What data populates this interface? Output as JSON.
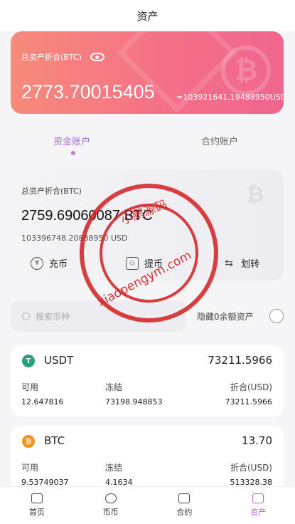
{
  "header": {
    "title": "资产"
  },
  "hero": {
    "label": "总资产折合(BTC)",
    "total": "2773.70015405",
    "approx": "≈103921641.19488950USD"
  },
  "tabs": [
    {
      "label": "资金账户",
      "active": true
    },
    {
      "label": "合约账户",
      "active": false
    }
  ],
  "account": {
    "label": "总资产折合(BTC)",
    "amount": "2759.69060087 BTC",
    "sub": "103396748.20888950 USD",
    "actions": [
      {
        "label": "充币",
        "icon": "deposit-icon"
      },
      {
        "label": "提币",
        "icon": "withdraw-icon"
      },
      {
        "label": "划转",
        "icon": "transfer-icon"
      }
    ]
  },
  "search": {
    "placeholder": "搜索币种",
    "hide_zero": "隐藏0余额资产"
  },
  "coins": [
    {
      "name": "USDT",
      "value": "73211.5966",
      "color": "#26a17b",
      "headers": [
        "可用",
        "冻结",
        "折合(USD)"
      ],
      "values": [
        "12.647816",
        "73198.948853",
        "73211.5966"
      ]
    },
    {
      "name": "BTC",
      "value": "13.70",
      "color": "#f7931a",
      "headers": [
        "可用",
        "冻结",
        "折合(USD)"
      ],
      "values": [
        "9.53749037",
        "4.1634",
        "513328.38"
      ]
    }
  ],
  "nav": [
    {
      "label": "首页",
      "active": false
    },
    {
      "label": "币币",
      "active": false
    },
    {
      "label": "合约",
      "active": false
    },
    {
      "label": "资产",
      "active": true
    }
  ],
  "watermark": {
    "top": "小鹏源码",
    "bottom": "xiaopengym.com"
  }
}
